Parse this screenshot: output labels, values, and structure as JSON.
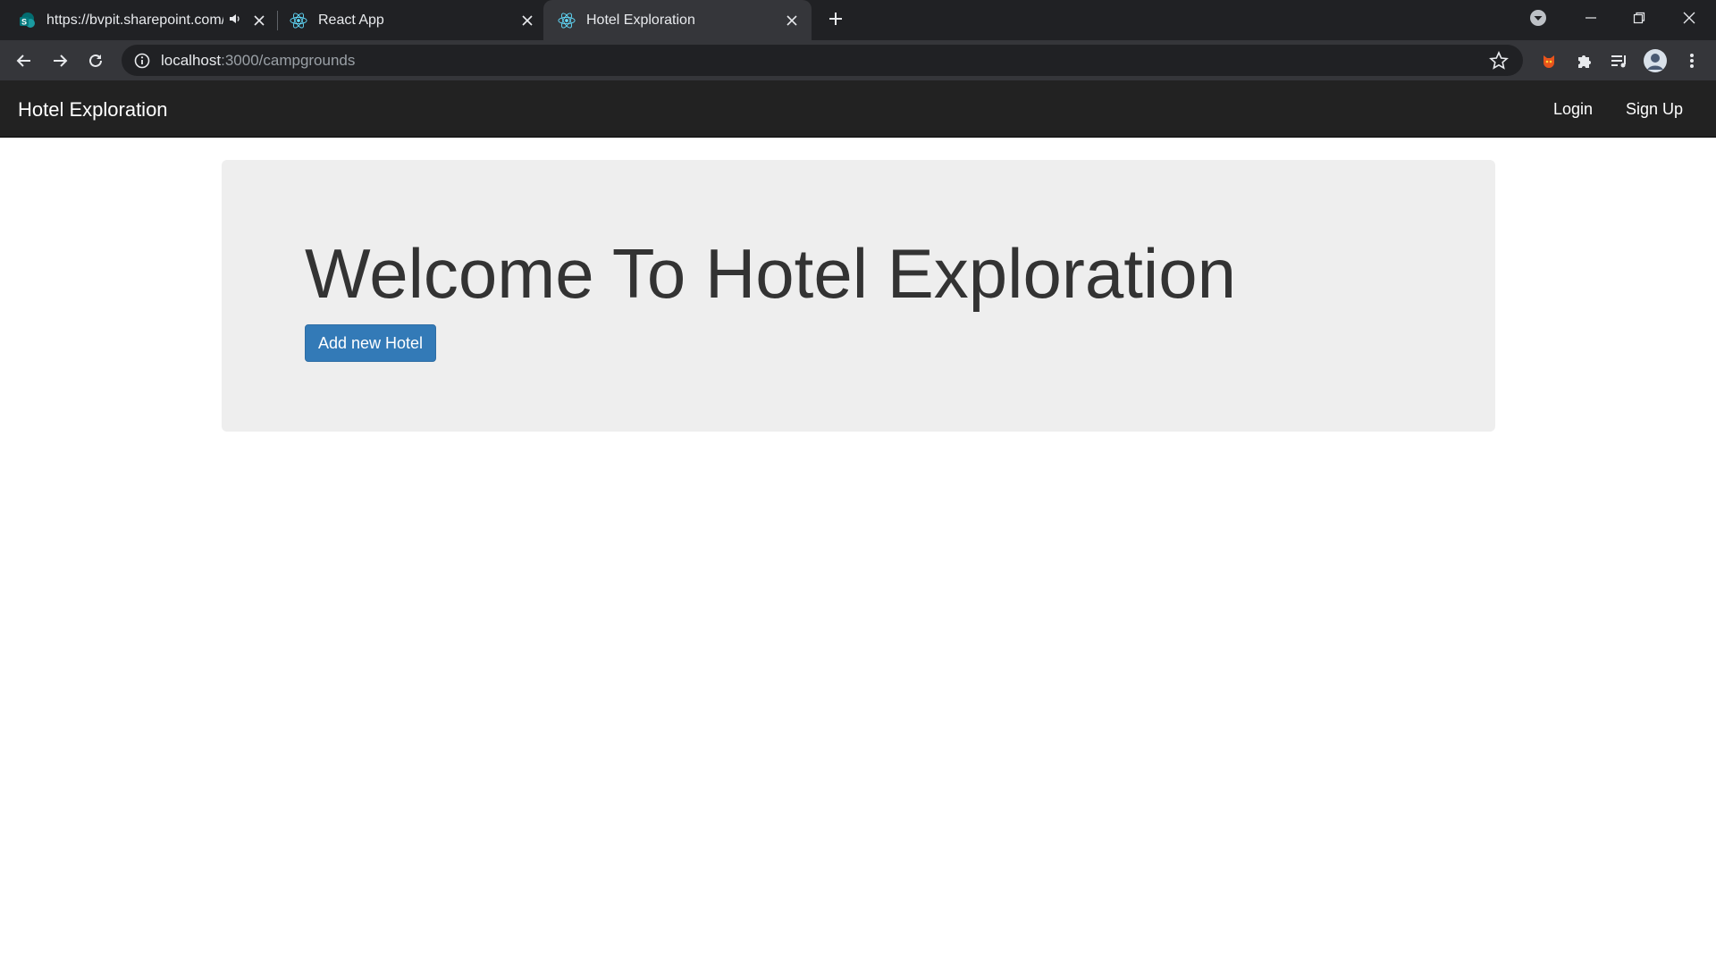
{
  "browser": {
    "tabs": [
      {
        "title": "https://bvpit.sharepoint.com/",
        "active": false,
        "icon": "sharepoint-icon",
        "audio": true
      },
      {
        "title": "React App",
        "active": false,
        "icon": "react-icon"
      },
      {
        "title": "Hotel Exploration",
        "active": true,
        "icon": "react-icon"
      }
    ],
    "new_tab_icon": "plus-icon",
    "url_host": "localhost",
    "url_path": ":3000/campgrounds"
  },
  "navbar": {
    "brand": "Hotel Exploration",
    "links": [
      "Login",
      "Sign Up"
    ]
  },
  "jumbotron": {
    "heading": "Welcome To Hotel Exploration",
    "button_label": "Add new Hotel"
  },
  "colors": {
    "navbar_bg": "#222222",
    "jumbotron_bg": "#eeeeee",
    "primary_button": "#337ab7",
    "chrome_dark": "#202124",
    "chrome_toolbar": "#35363a"
  }
}
